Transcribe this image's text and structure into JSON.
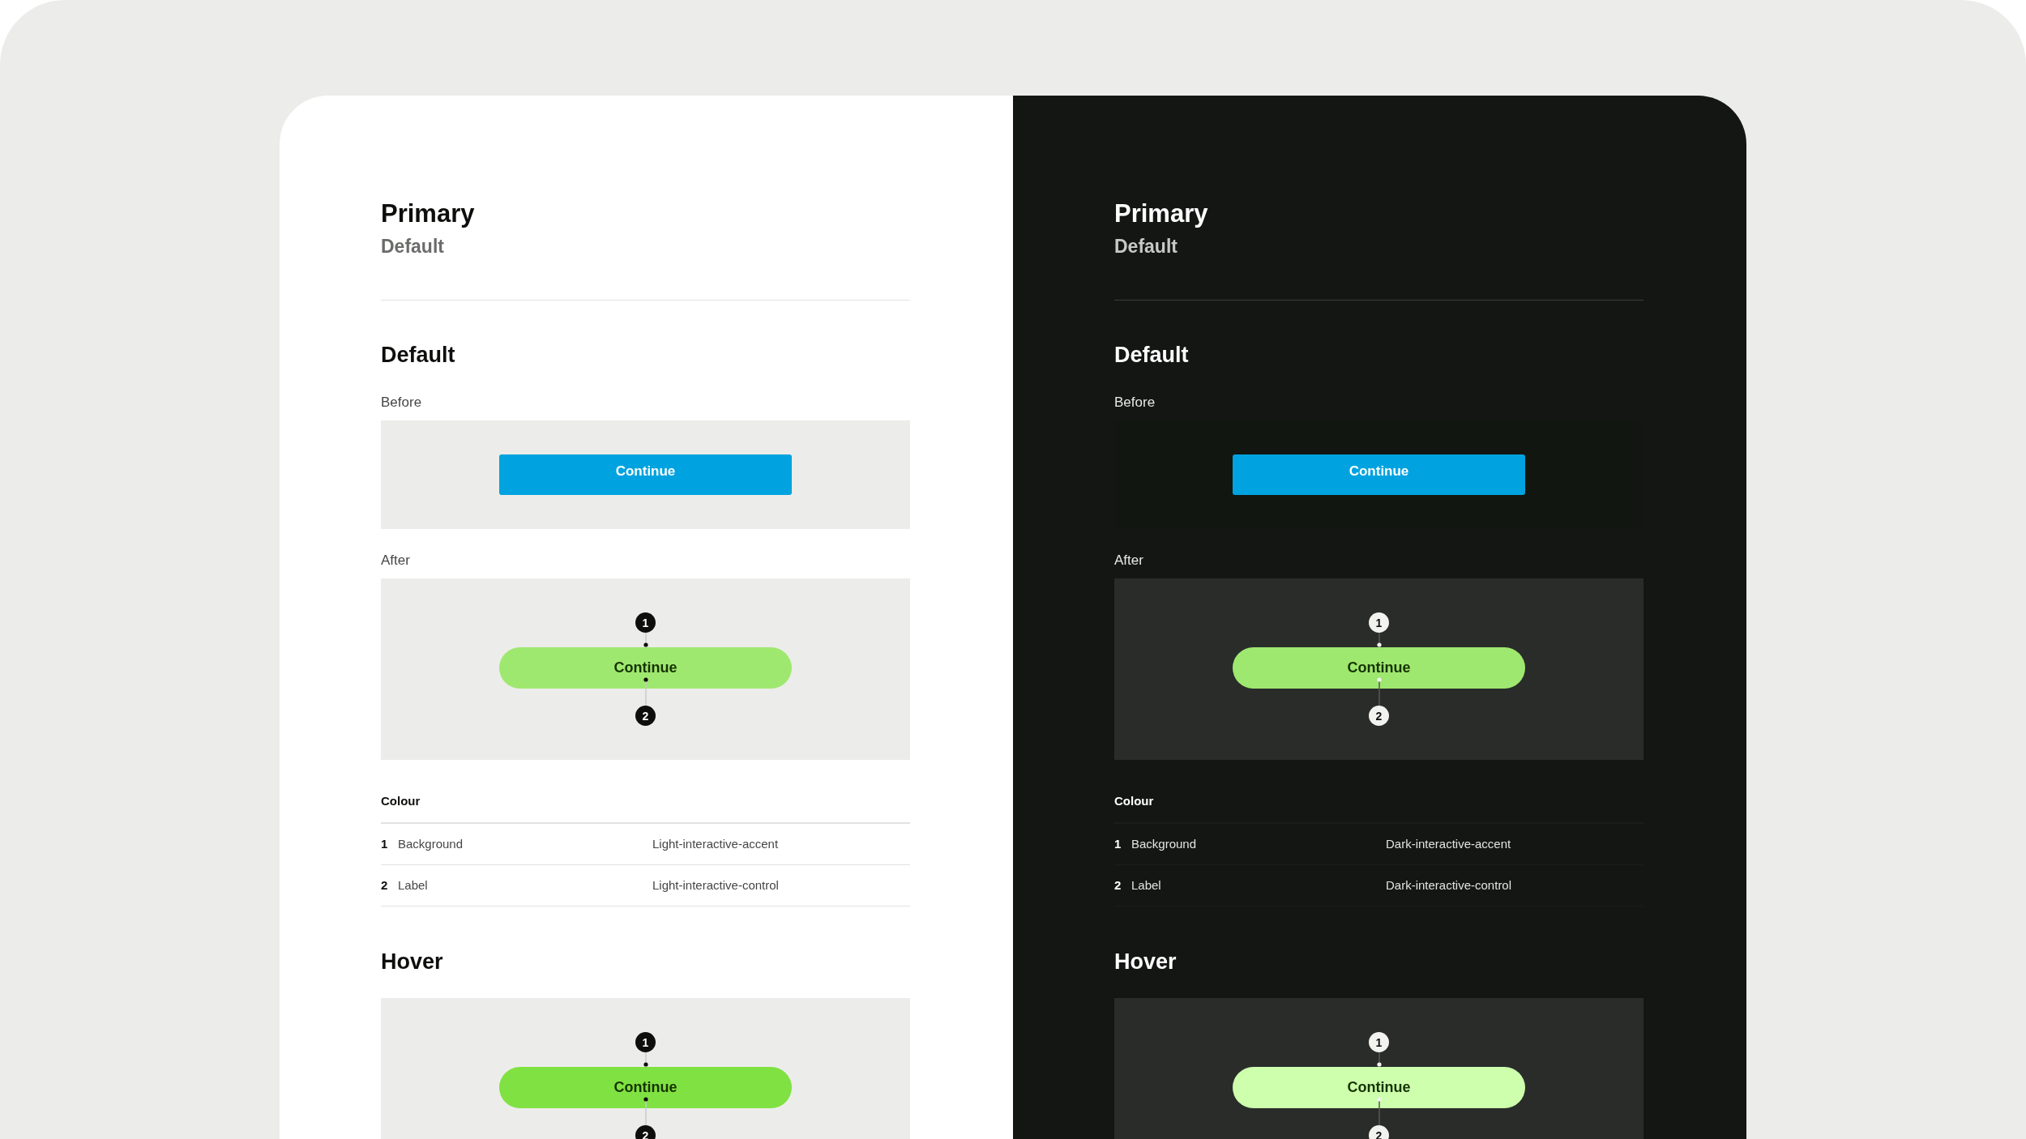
{
  "panels": [
    {
      "kind": "light",
      "title": "Primary",
      "subtitle": "Default",
      "sections": [
        {
          "heading": "Default",
          "examples": [
            {
              "caption": "Before",
              "kind": "square",
              "button": {
                "label": "Continue",
                "color": "#00a3df"
              }
            },
            {
              "caption": "After",
              "kind": "pill",
              "button": {
                "label": "Continue",
                "color": "#9fe870"
              },
              "markers": [
                "1",
                "2"
              ]
            }
          ],
          "colour": {
            "heading": "Colour",
            "rows": [
              {
                "number": "1",
                "name": "Background",
                "token": "Light-interactive-accent"
              },
              {
                "number": "2",
                "name": "Label",
                "token": "Light-interactive-control"
              }
            ]
          }
        },
        {
          "heading": "Hover",
          "examples": [
            {
              "kind": "pill",
              "button": {
                "label": "Continue",
                "color": "#80e142"
              },
              "markers": [
                "1",
                "2"
              ]
            }
          ]
        }
      ]
    },
    {
      "kind": "dark",
      "title": "Primary",
      "subtitle": "Default",
      "sections": [
        {
          "heading": "Default",
          "examples": [
            {
              "caption": "Before",
              "kind": "square",
              "button": {
                "label": "Continue",
                "color": "#00a3df"
              }
            },
            {
              "caption": "After",
              "kind": "pill",
              "button": {
                "label": "Continue",
                "color": "#9fe870"
              },
              "markers": [
                "1",
                "2"
              ]
            }
          ],
          "colour": {
            "heading": "Colour",
            "rows": [
              {
                "number": "1",
                "name": "Background",
                "token": "Dark-interactive-accent"
              },
              {
                "number": "2",
                "name": "Label",
                "token": "Dark-interactive-control"
              }
            ]
          }
        },
        {
          "heading": "Hover",
          "examples": [
            {
              "kind": "pill",
              "button": {
                "label": "Continue",
                "color": "#cdffad"
              },
              "markers": [
                "1",
                "2"
              ]
            }
          ]
        }
      ]
    }
  ]
}
